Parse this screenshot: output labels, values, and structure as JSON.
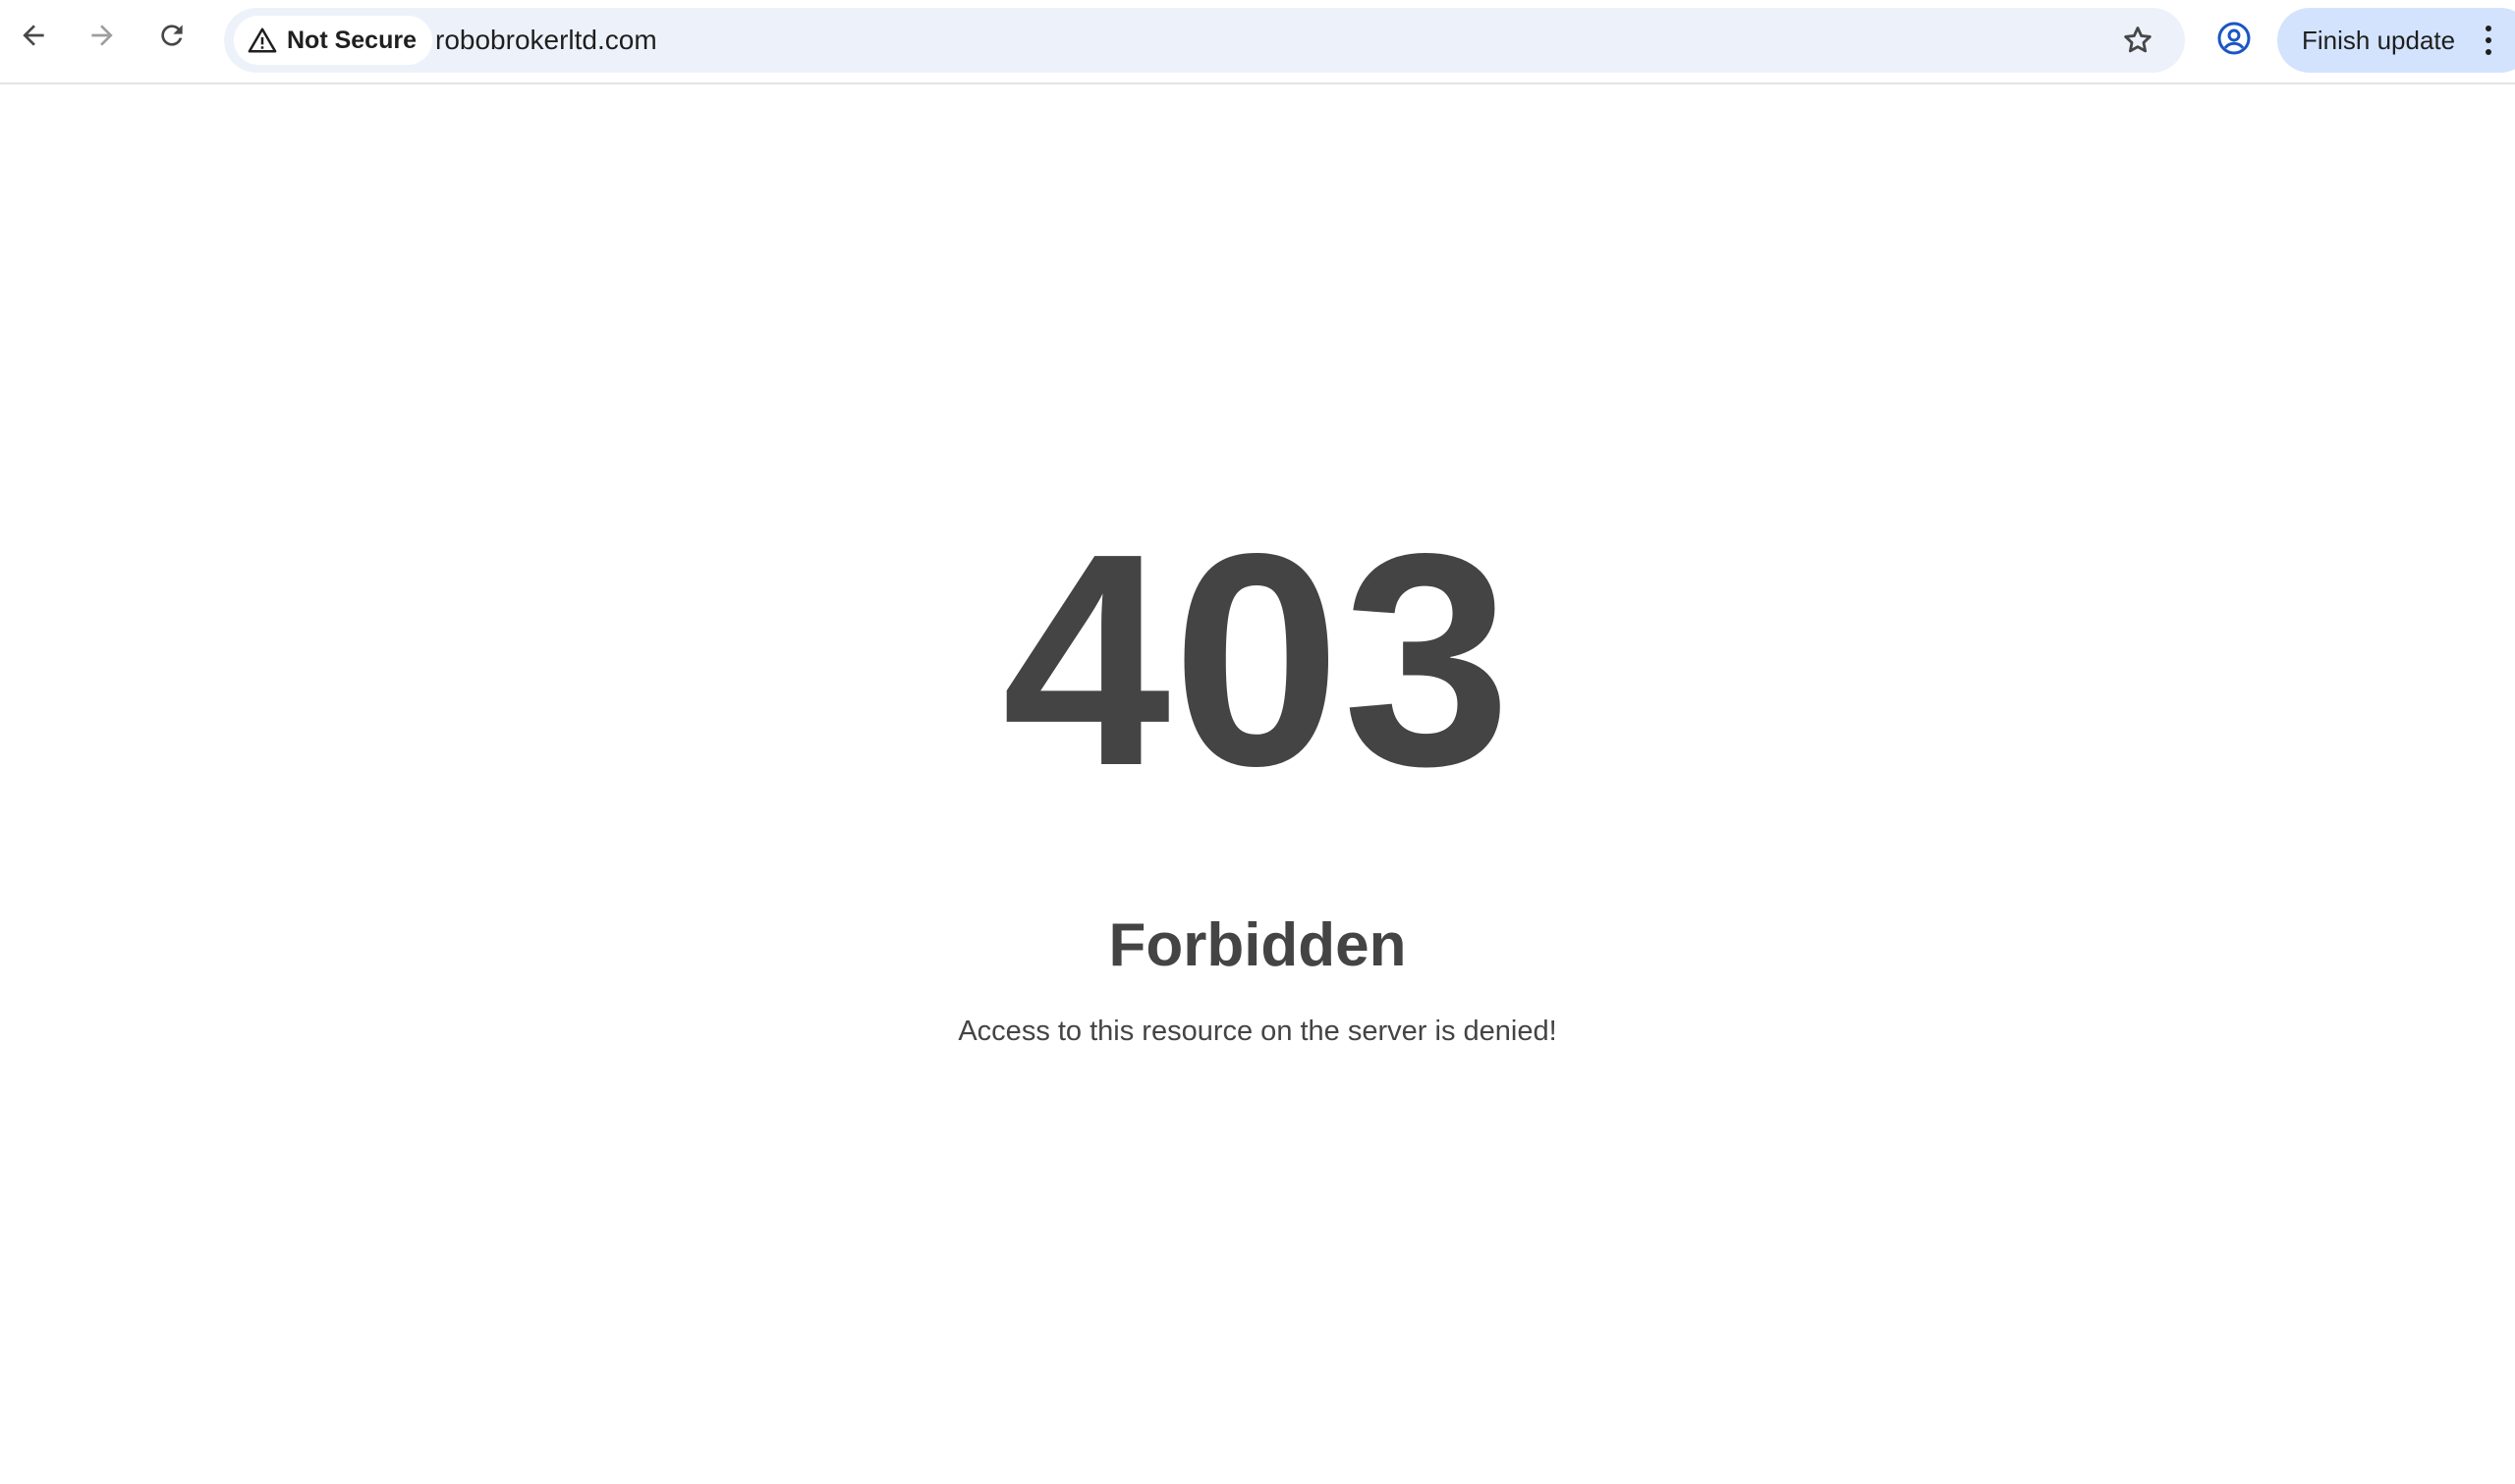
{
  "browser": {
    "security_label": "Not Secure",
    "url": "robobrokerltd.com",
    "update_button_label": "Finish update",
    "icons": {
      "back": "arrow-left-icon",
      "forward": "arrow-right-icon",
      "reload": "reload-icon",
      "warning": "warning-triangle-icon",
      "bookmark": "star-icon",
      "profile": "account-circle-icon",
      "menu": "kebab-menu-icon"
    },
    "colors": {
      "omnibox_bg": "#edf2fa",
      "update_button_bg": "#d3e3fd",
      "profile_icon": "#1a56c4"
    }
  },
  "page": {
    "error_code": "403",
    "error_title": "Forbidden",
    "error_message": "Access to this resource on the server is denied!",
    "text_color": "#444444"
  }
}
